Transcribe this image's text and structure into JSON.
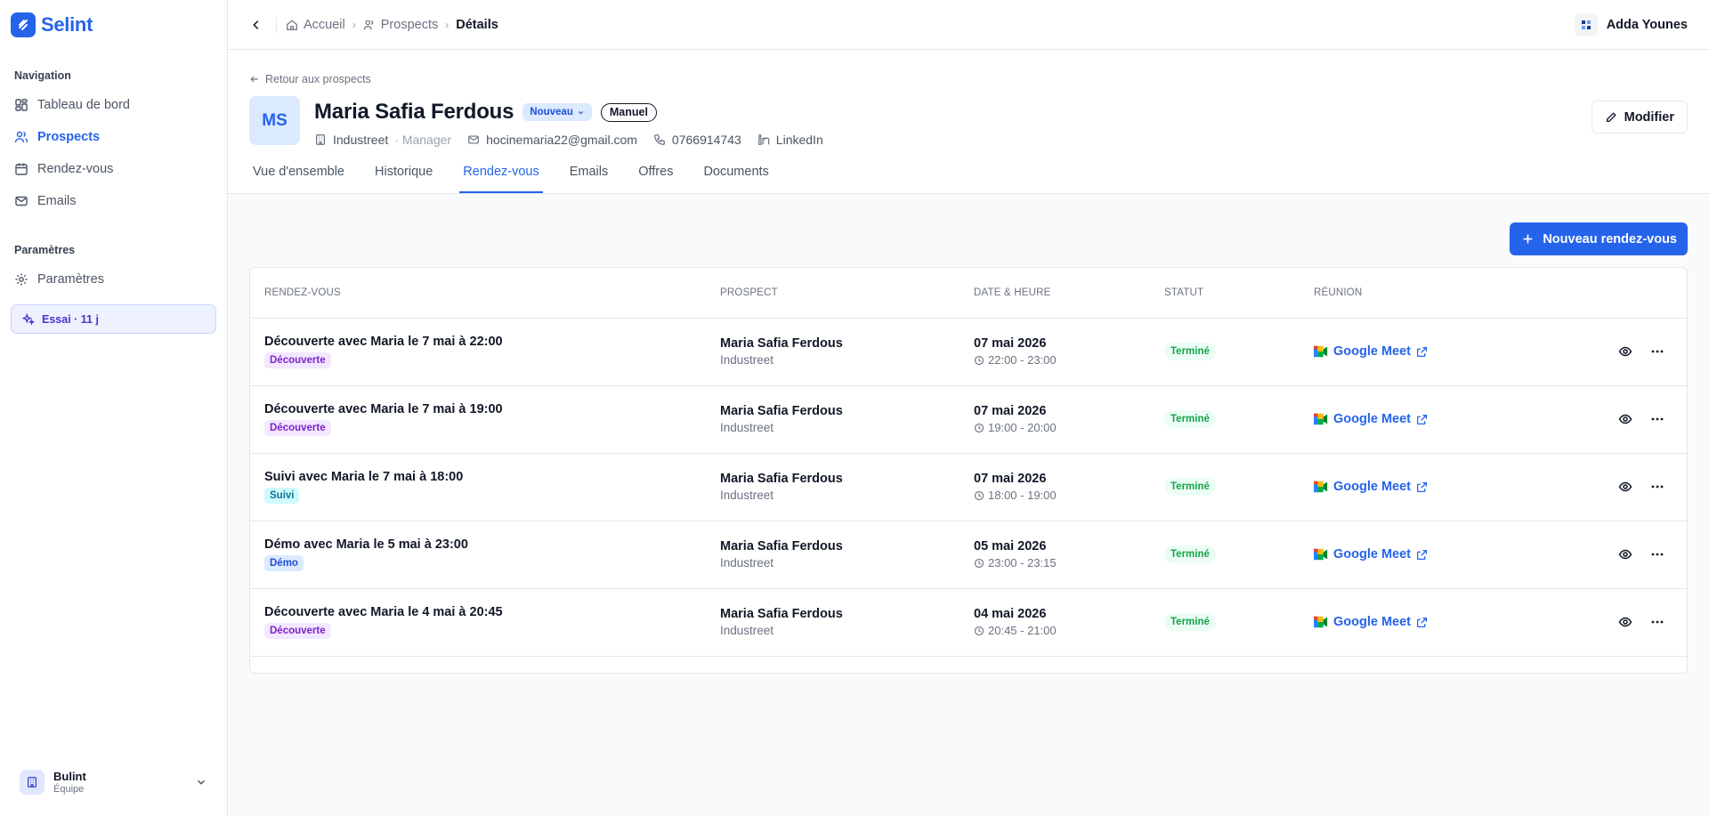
{
  "brand": {
    "name": "Selint"
  },
  "sidebar": {
    "nav_heading": "Navigation",
    "items": [
      {
        "label": "Tableau de bord",
        "icon": "dashboard-icon"
      },
      {
        "label": "Prospects",
        "icon": "users-icon",
        "active": true
      },
      {
        "label": "Rendez-vous",
        "icon": "calendar-icon"
      },
      {
        "label": "Emails",
        "icon": "mail-icon"
      }
    ],
    "settings_heading": "Paramètres",
    "settings_items": [
      {
        "label": "Paramètres",
        "icon": "gear-icon"
      }
    ],
    "trial": "Essai · 11 j",
    "team": {
      "name": "Bulint",
      "role": "Équipe"
    }
  },
  "topbar": {
    "breadcrumbs": [
      "Accueil",
      "Prospects",
      "Détails"
    ],
    "user": "Adda Younes"
  },
  "header": {
    "back_link": "Retour aux prospects",
    "initials": "MS",
    "name": "Maria Safia Ferdous",
    "status_badge": "Nouveau",
    "source_badge": "Manuel",
    "company": "Industreet",
    "role": "· Manager",
    "email": "hocinemaria22@gmail.com",
    "phone": "0766914743",
    "linkedin": "LinkedIn",
    "edit_label": "Modifier",
    "tabs": [
      "Vue d'ensemble",
      "Historique",
      "Rendez-vous",
      "Emails",
      "Offres",
      "Documents"
    ],
    "active_tab": "Rendez-vous"
  },
  "content": {
    "new_button": "Nouveau rendez-vous",
    "columns": [
      "Rendez-vous",
      "Prospect",
      "Date & heure",
      "Statut",
      "Réunion"
    ],
    "rows": [
      {
        "title": "Découverte avec Maria le 7 mai à 22:00",
        "tag": "Découverte",
        "prospect": "Maria Safia Ferdous",
        "company": "Industreet",
        "date": "07 mai 2026",
        "time": "22:00 - 23:00",
        "status": "Terminé",
        "meeting": "Google Meet"
      },
      {
        "title": "Découverte avec Maria le 7 mai à 19:00",
        "tag": "Découverte",
        "prospect": "Maria Safia Ferdous",
        "company": "Industreet",
        "date": "07 mai 2026",
        "time": "19:00 - 20:00",
        "status": "Terminé",
        "meeting": "Google Meet"
      },
      {
        "title": "Suivi avec Maria le 7 mai à 18:00",
        "tag": "Suivi",
        "prospect": "Maria Safia Ferdous",
        "company": "Industreet",
        "date": "07 mai 2026",
        "time": "18:00 - 19:00",
        "status": "Terminé",
        "meeting": "Google Meet"
      },
      {
        "title": "Démo avec Maria le 5 mai à 23:00",
        "tag": "Démo",
        "prospect": "Maria Safia Ferdous",
        "company": "Industreet",
        "date": "05 mai 2026",
        "time": "23:00 - 23:15",
        "status": "Terminé",
        "meeting": "Google Meet"
      },
      {
        "title": "Découverte avec Maria le 4 mai à 20:45",
        "tag": "Découverte",
        "prospect": "Maria Safia Ferdous",
        "company": "Industreet",
        "date": "04 mai 2026",
        "time": "20:45 - 21:00",
        "status": "Terminé",
        "meeting": "Google Meet"
      }
    ]
  },
  "colors": {
    "accent": "#2563eb",
    "success": "#16a34a",
    "tag_decouverte": "#7e22ce",
    "tag_suivi": "#0e7490",
    "tag_demo": "#1d4ed8"
  }
}
